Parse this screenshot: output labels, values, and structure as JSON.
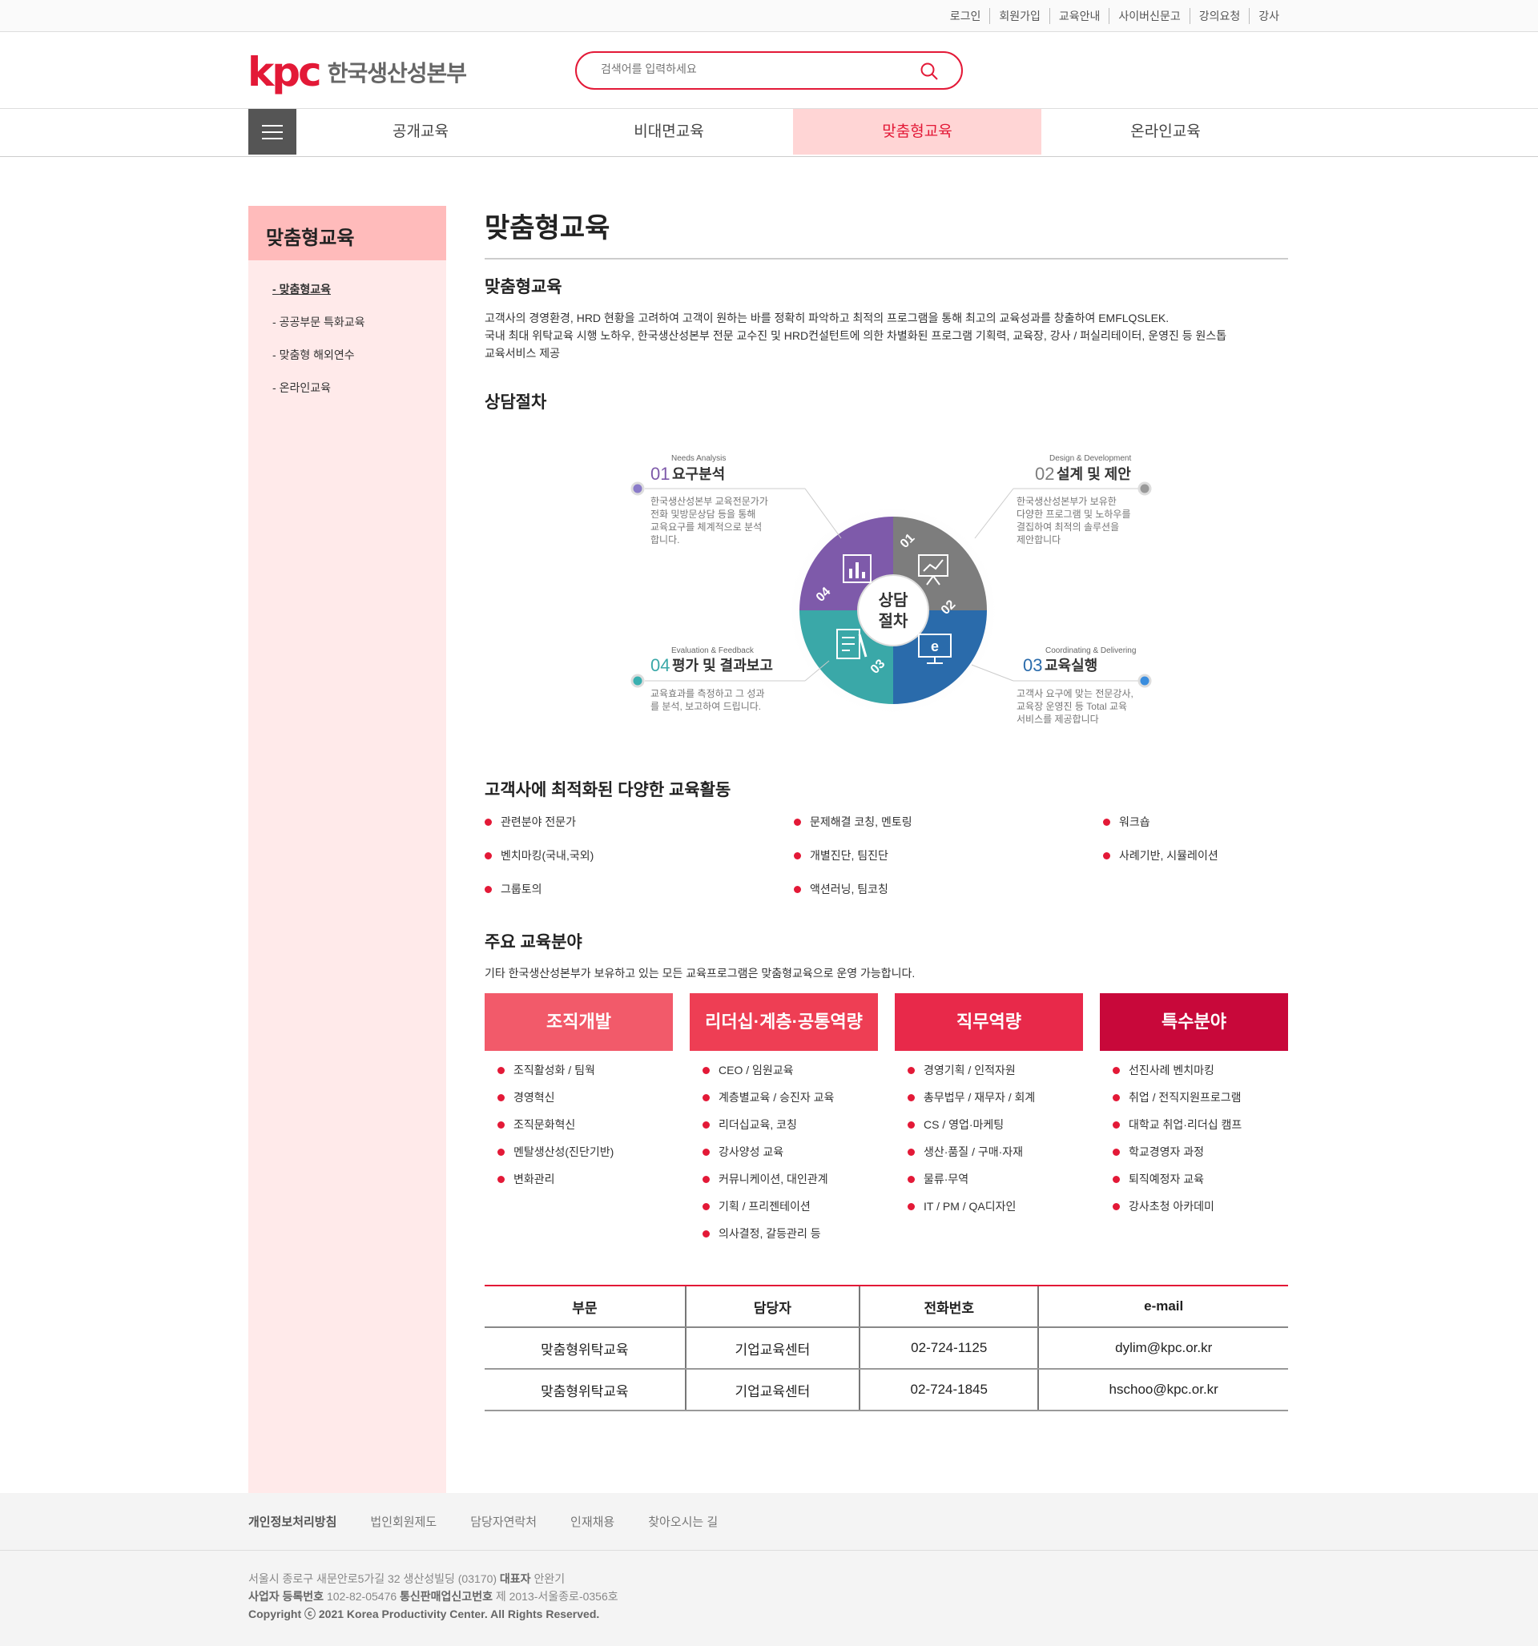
{
  "top_links": [
    "로그인",
    "회원가입",
    "교육안내",
    "사이버신문고",
    "강의요청",
    "강사"
  ],
  "logo": {
    "mark": "kpc",
    "text": "한국생산성본부"
  },
  "search": {
    "placeholder": "검색어를 입력하세요"
  },
  "gnb": [
    "공개교육",
    "비대면교육",
    "맞춤형교육",
    "온라인교육"
  ],
  "sidebar": {
    "title": "맞춤형교육",
    "items": [
      "맞춤형교육",
      "공공부문 특화교육",
      "맞춤형 해외연수",
      "온라인교육"
    ]
  },
  "main": {
    "page_title": "맞춤형교육",
    "section1_title": "맞춤형교육",
    "desc_lines": [
      "고객사의 경영환경, HRD 현황을 고려하여 고객이 원하는 바를 정확히 파악하고 최적의 프로그램을 통해 최고의 교육성과를 창출하여 EMFLQSLEK.",
      "국내 최대 위탁교육 시행 노하우, 한국생산성본부 전문 교수진 및 HRD컨설턴트에 의한 차별화된 프로그램 기획력, 교육장, 강사 / 퍼실리테이터, 운영진 등 원스톱",
      "교육서비스 제공"
    ],
    "section2_title": "상담절차",
    "diagram": {
      "center": [
        "상담",
        "절차"
      ],
      "steps": [
        {
          "en": "Needs Analysis",
          "num": "01",
          "title": "요구분석",
          "desc": [
            "한국생산성본부 교육전문가가",
            "전화 및방문상담 등을 통해",
            "교육요구를 체계적으로 분석",
            "합니다."
          ]
        },
        {
          "en": "Design & Development",
          "num": "02",
          "title": "설계 및 제안",
          "desc": [
            "한국생산성본부가 보유한",
            "다양한 프로그램 및 노하우를",
            "결집하여 최적의 솔루션을",
            "제안합니다"
          ]
        },
        {
          "en": "Coordinating & Delivering",
          "num": "03",
          "title": "교육실행",
          "desc": [
            "고객사 요구에 맞는 전문강사,",
            "교육장 운영진 등 Total 교육",
            "서비스를 제공합니다"
          ]
        },
        {
          "en": "Evaluation & Feedback",
          "num": "04",
          "title": "평가 및 결과보고",
          "desc": [
            "교육효과를 측정하고 그 성과",
            "를 분석, 보고하여 드립니다."
          ]
        }
      ]
    },
    "section3_title": "고객사에 최적화된 다양한 교육활동",
    "activities": [
      "관련분야 전문가",
      "문제해결 코칭, 멘토링",
      "워크숍",
      "벤치마킹(국내,국외)",
      "개별진단, 팀진단",
      "사례기반, 시뮬레이션",
      "그룹토의",
      "액션러닝, 팀코칭"
    ],
    "section4_title": "주요 교육분야",
    "section4_desc": "기타 한국생산성본부가 보유하고 있는 모든 교육프로그램은 맞춤형교육으로 운영 가능합니다.",
    "fields": [
      {
        "title": "조직개발",
        "color": "#f25a6a",
        "items": [
          "조직활성화 / 팀웍",
          "경영혁신",
          "조직문화혁신",
          "멘탈생산성(진단기반)",
          "변화관리"
        ]
      },
      {
        "title": "리더십·계층·공통역량",
        "color": "#ee3e54",
        "items": [
          "CEO / 임원교육",
          "계층별교육 / 승진자 교육",
          "리더십교육, 코칭",
          "강사양성 교육",
          "커뮤니케이션, 대인관계",
          "기획 / 프리젠테이션",
          "의사결정, 갈등관리 등"
        ]
      },
      {
        "title": "직무역량",
        "color": "#e8294a",
        "items": [
          "경영기획 / 인적자원",
          "총무법무 / 재무자 / 회계",
          "CS / 영업·마케팅",
          "생산·품질 / 구매·자재",
          "물류·무역",
          "IT / PM / QA디자인"
        ]
      },
      {
        "title": "특수분야",
        "color": "#c8083a",
        "items": [
          "선진사례 벤치마킹",
          "취업 / 전직지원프로그램",
          "대학교 취업·리더십 캠프",
          "학교경영자 과정",
          "퇴직예정자 교육",
          "강사초청 아카데미"
        ]
      }
    ],
    "table": {
      "headers": [
        "부문",
        "담당자",
        "전화번호",
        "e-mail"
      ],
      "rows": [
        [
          "맞춤형위탁교육",
          "기업교육센터",
          "02-724-1125",
          "dylim@kpc.or.kr"
        ],
        [
          "맞춤형위탁교육",
          "기업교육센터",
          "02-724-1845",
          "hschoo@kpc.or.kr"
        ]
      ]
    }
  },
  "footer": {
    "links": [
      "개인정보처리방침",
      "법인회원제도",
      "담당자연락처",
      "인재채용",
      "찾아오시는 길"
    ],
    "address": "서울시 종로구 새문안로5가길 32 생산성빌딩 (03170)",
    "ceo_label": "대표자",
    "ceo": "안완기",
    "biz_label": "사업자 등록번호",
    "biz_no": "102-82-05476",
    "mail_label": "통신판매업신고번호",
    "mail_no": "제 2013-서울종로-0356호",
    "copyright": "Copyright ⓒ 2021 Korea Productivity Center. All Rights Reserved."
  }
}
